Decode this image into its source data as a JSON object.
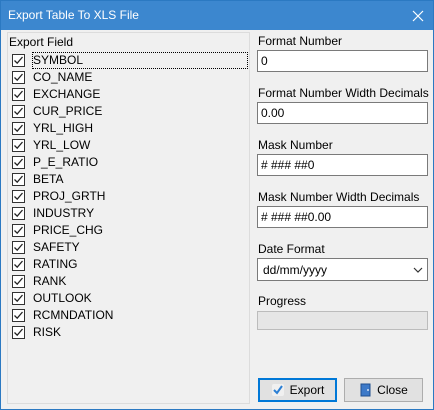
{
  "window": {
    "title": "Export Table To XLS File"
  },
  "export_field": {
    "label": "Export Field",
    "items": [
      {
        "label": "SYMBOL",
        "checked": true
      },
      {
        "label": "CO_NAME",
        "checked": true
      },
      {
        "label": "EXCHANGE",
        "checked": true
      },
      {
        "label": "CUR_PRICE",
        "checked": true
      },
      {
        "label": "YRL_HIGH",
        "checked": true
      },
      {
        "label": "YRL_LOW",
        "checked": true
      },
      {
        "label": "P_E_RATIO",
        "checked": true
      },
      {
        "label": "BETA",
        "checked": true
      },
      {
        "label": "PROJ_GRTH",
        "checked": true
      },
      {
        "label": "INDUSTRY",
        "checked": true
      },
      {
        "label": "PRICE_CHG",
        "checked": true
      },
      {
        "label": "SAFETY",
        "checked": true
      },
      {
        "label": "RATING",
        "checked": true
      },
      {
        "label": "RANK",
        "checked": true
      },
      {
        "label": "OUTLOOK",
        "checked": true
      },
      {
        "label": "RCMNDATION",
        "checked": true
      },
      {
        "label": "RISK",
        "checked": true
      }
    ]
  },
  "format_number": {
    "label": "Format Number",
    "value": "0"
  },
  "format_number_decimals": {
    "label": "Format Number Width Decimals",
    "value": "0.00"
  },
  "mask_number": {
    "label": "Mask Number",
    "value": "# ### ##0"
  },
  "mask_number_decimals": {
    "label": "Mask Number Width Decimals",
    "value": "# ### ##0.00"
  },
  "date_format": {
    "label": "Date Format",
    "value": "dd/mm/yyyy"
  },
  "progress": {
    "label": "Progress",
    "value": 0
  },
  "buttons": {
    "export_label": "Export",
    "close_label": "Close"
  },
  "icons": {
    "close": "close-icon",
    "check": "check-icon",
    "export": "export-icon",
    "exit": "exit-door-icon",
    "dropdown": "chevron-down-icon"
  },
  "colors": {
    "titlebar": "#3c87cf",
    "accent": "#0078d7",
    "progress_fill": "#06b025"
  }
}
